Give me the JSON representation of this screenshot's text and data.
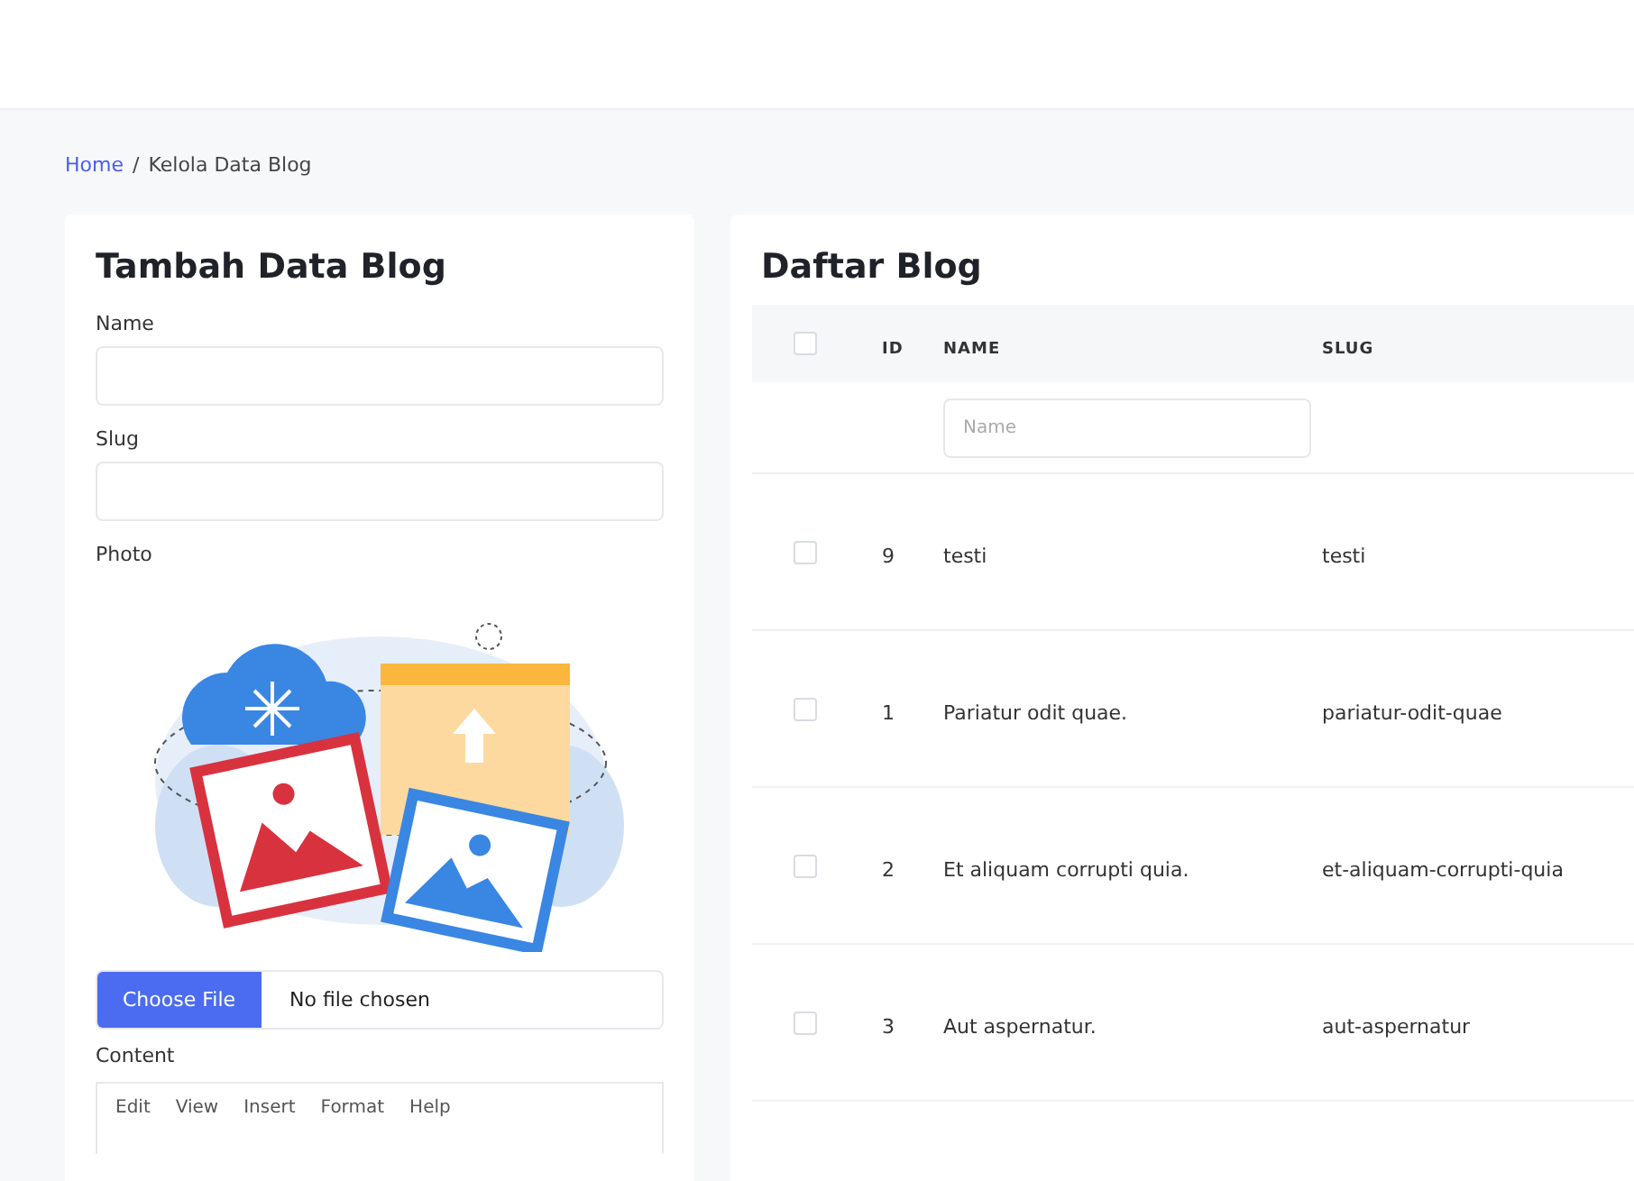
{
  "breadcrumb": [
    {
      "label": "Home",
      "link": true
    },
    {
      "label": "/",
      "link": false
    },
    {
      "label": "Kelola Data Blog",
      "link": false
    }
  ],
  "form": {
    "title": "Tambah Data Blog",
    "fields": [
      {
        "kind": "text",
        "label": "Name"
      },
      {
        "kind": "text",
        "label": "Slug"
      },
      {
        "kind": "photo",
        "label": "Photo",
        "button": "Choose File",
        "file_status": "No file chosen"
      },
      {
        "kind": "editor",
        "label": "Content",
        "menu": [
          "Edit",
          "View",
          "Insert",
          "Format",
          "Help"
        ]
      }
    ]
  },
  "list": {
    "title": "Daftar Blog",
    "select_all": {
      "checked": false
    },
    "columns": [
      "ID",
      "NAME",
      "SLUG"
    ],
    "filter": {
      "placeholder": "Name"
    },
    "rows": [
      {
        "checked": false,
        "id": "9",
        "name": "testi",
        "slug": "testi"
      },
      {
        "checked": false,
        "id": "1",
        "name": "Pariatur odit quae.",
        "slug": "pariatur-odit-quae"
      },
      {
        "checked": false,
        "id": "2",
        "name": "Et aliquam corrupti quia.",
        "slug": "et-aliquam-corrupti-quia"
      },
      {
        "checked": false,
        "id": "3",
        "name": "Aut aspernatur.",
        "slug": "aut-aspernatur"
      }
    ]
  }
}
